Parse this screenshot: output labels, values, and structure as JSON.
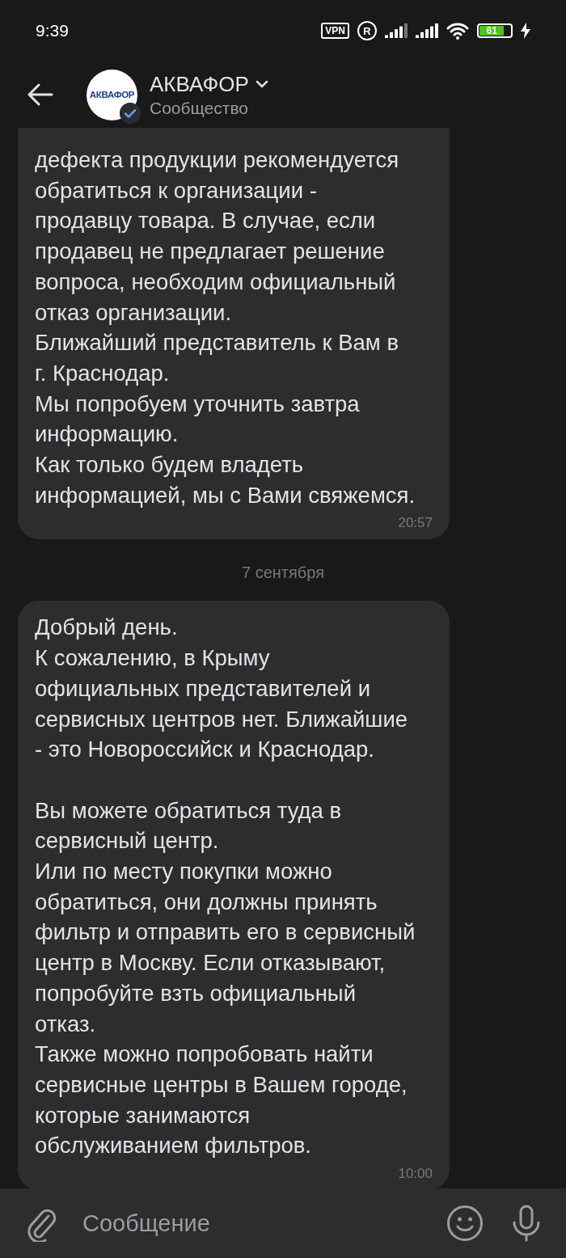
{
  "status_bar": {
    "time": "9:39",
    "vpn": "VPN",
    "roaming": "R",
    "battery": "61",
    "charging": true
  },
  "header": {
    "title": "АКВАФОР",
    "subtitle": "Сообщество",
    "avatar_logo": "АКВАФОР",
    "verified": true
  },
  "messages": [
    {
      "kind": "message",
      "continued": true,
      "text": "дефекта продукции рекомендуется\nобратиться к организации -\nпродавцу товара. В случае, если\nпродавец не предлагает решение\nвопроса, необходим официальный\nотказ организации.\nБлижайший представитель к Вам в\nг. Краснодар.\nМы попробуем уточнить завтра\nинформацию.\nКак только будем владеть\nинформацией, мы с Вами свяжемся.",
      "time": "20:57"
    },
    {
      "kind": "date",
      "text": "7 сентября"
    },
    {
      "kind": "message",
      "text": "Добрый день.\nК сожалению, в Крыму\nофициальных представителей и\nсервисных центров нет. Ближайшие\n- это Новороссийск и Краснодар.\n\nВы можете обратиться туда в\nсервисный центр.\nИли по месту покупки можно\nобратиться, они должны принять\nфильтр и отправить его в сервисный\nцентр в Москву. Если отказывают,\nпопробуйте взть официальный\nотказ.\nТакже можно попробовать найти\nсервисные центры в Вашем городе,\nкоторые занимаются\nобслуживанием фильтров.",
      "time": "10:00"
    }
  ],
  "composer": {
    "placeholder": "Сообщение"
  }
}
